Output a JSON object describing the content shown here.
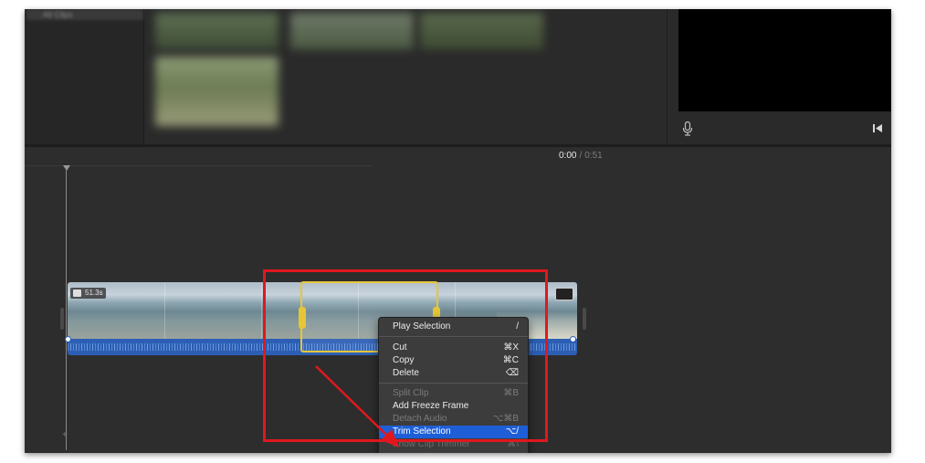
{
  "library": {
    "label": "All Clips"
  },
  "viewer": {
    "mic_icon": "microphone-icon",
    "skip_icon": "skip-to-start-icon"
  },
  "timeline": {
    "current_time": "0:00",
    "separator": "/",
    "total_duration": "0:51"
  },
  "clip": {
    "duration_badge": "51.3s"
  },
  "context_menu": {
    "items": [
      {
        "label": "Play Selection",
        "shortcut": "/",
        "state": "enabled"
      },
      {
        "label": "Cut",
        "shortcut": "⌘X",
        "state": "enabled"
      },
      {
        "label": "Copy",
        "shortcut": "⌘C",
        "state": "enabled"
      },
      {
        "label": "Delete",
        "shortcut": "⌫",
        "state": "enabled"
      },
      {
        "label": "Split Clip",
        "shortcut": "⌘B",
        "state": "disabled"
      },
      {
        "label": "Add Freeze Frame",
        "shortcut": "",
        "state": "enabled"
      },
      {
        "label": "Detach Audio",
        "shortcut": "⌥⌘B",
        "state": "disabled"
      },
      {
        "label": "Trim Selection",
        "shortcut": "⌥/",
        "state": "highlighted"
      },
      {
        "label": "Show Clip Trimmer",
        "shortcut": "⌘\\",
        "state": "partially-hidden"
      }
    ]
  },
  "colors": {
    "annotation_red": "#e0181e",
    "selection_yellow": "#e6c637",
    "highlight_blue": "#1e5fd8",
    "audio_blue": "#2c5fb4"
  }
}
